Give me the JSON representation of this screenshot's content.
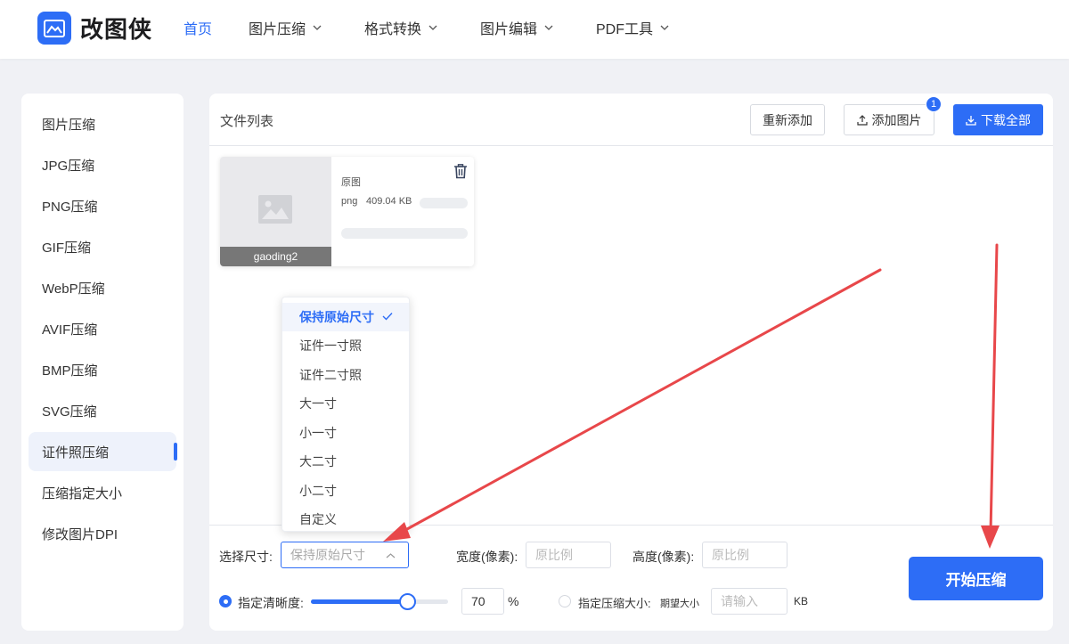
{
  "brand": {
    "name": "改图侠"
  },
  "nav": {
    "home": "首页",
    "items": [
      "图片压缩",
      "格式转换",
      "图片编辑",
      "PDF工具"
    ]
  },
  "sidebar": {
    "items": [
      "图片压缩",
      "JPG压缩",
      "PNG压缩",
      "GIF压缩",
      "WebP压缩",
      "AVIF压缩",
      "BMP压缩",
      "SVG压缩",
      "证件照压缩",
      "压缩指定大小",
      "修改图片DPI"
    ],
    "active": "证件照压缩"
  },
  "file_list": {
    "title": "文件列表",
    "readd_label": "重新添加",
    "add_label": "添加图片",
    "add_badge": "1",
    "download_label": "下载全部"
  },
  "file_card": {
    "name": "gaoding2",
    "original_label": "原图",
    "format": "png",
    "size": "409.04 KB"
  },
  "size_dropdown": {
    "options": [
      "保持原始尺寸",
      "证件一寸照",
      "证件二寸照",
      "大一寸",
      "小一寸",
      "大二寸",
      "小二寸",
      "自定义"
    ],
    "selected": "保持原始尺寸"
  },
  "controls": {
    "size_label": "选择尺寸:",
    "size_placeholder": "保持原始尺寸",
    "width_label": "宽度(像素):",
    "width_placeholder": "原比例",
    "height_label": "高度(像素):",
    "height_placeholder": "原比例",
    "clarity_label": "指定清晰度:",
    "clarity_value": "70",
    "clarity_percent": 70,
    "percent_unit": "%",
    "target_size_label": "指定压缩大小:",
    "expected_size_label": "期望大小",
    "expected_size_placeholder": "请输入",
    "kb_unit": "KB",
    "start_label": "开始压缩"
  },
  "colors": {
    "accent": "#2d6df6",
    "annotation_arrow": "#e8474a"
  }
}
